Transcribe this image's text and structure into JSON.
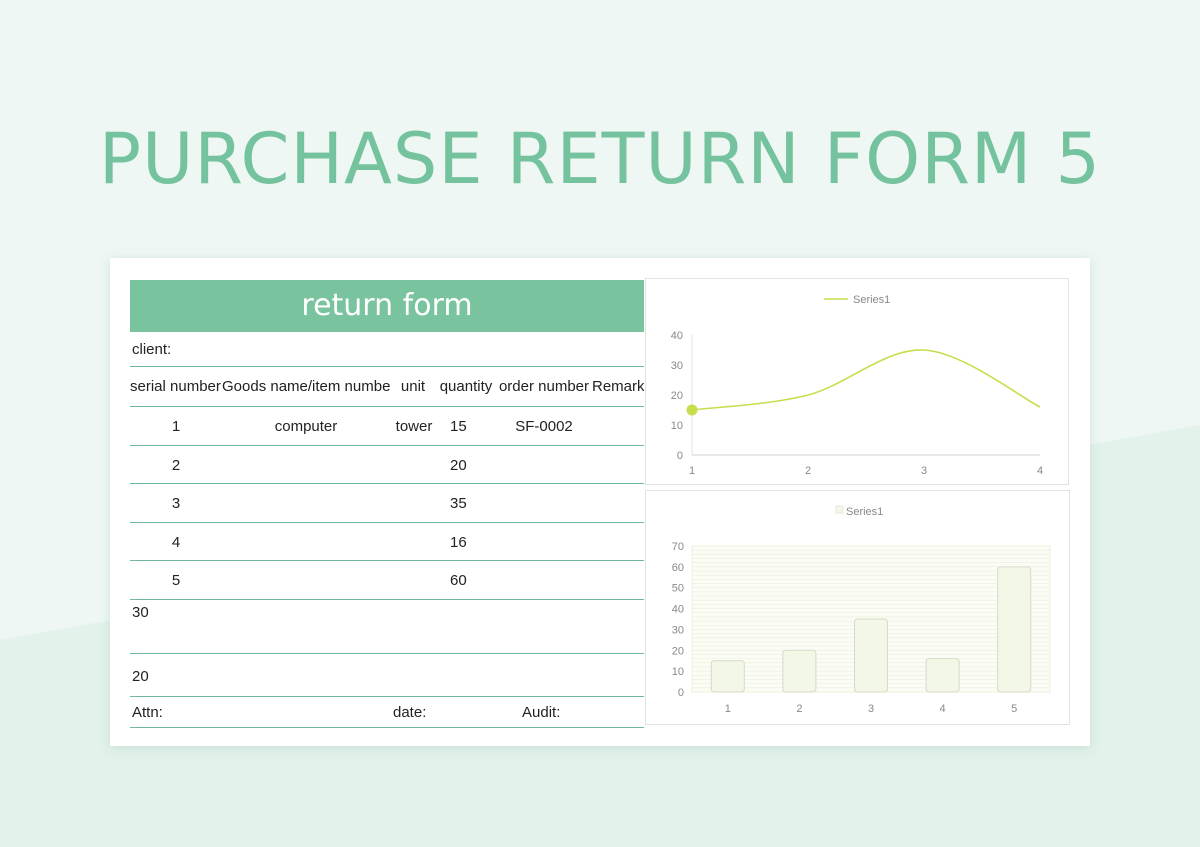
{
  "page": {
    "title": "PURCHASE RETURN FORM 5",
    "colors": {
      "title": "#74c39e",
      "header_band": "#79c39f",
      "rule": "#6fb99a",
      "line_series": "#c9dc4b",
      "bar_fill": "#f3f7e8"
    }
  },
  "form": {
    "header": "return form",
    "client_label": "client:",
    "columns": [
      "serial number",
      "Goods name/item number",
      "unit",
      "quantity",
      "order number",
      "Remark"
    ],
    "rows": [
      {
        "serial": "1",
        "goods": "computer",
        "unit": "tower",
        "quantity": "15",
        "order": "SF-0002",
        "remark": ""
      },
      {
        "serial": "2",
        "goods": "",
        "unit": "",
        "quantity": "20",
        "order": "",
        "remark": ""
      },
      {
        "serial": "3",
        "goods": "",
        "unit": "",
        "quantity": "35",
        "order": "",
        "remark": ""
      },
      {
        "serial": "4",
        "goods": "",
        "unit": "",
        "quantity": "16",
        "order": "",
        "remark": ""
      },
      {
        "serial": "5",
        "goods": "",
        "unit": "",
        "quantity": "60",
        "order": "",
        "remark": ""
      }
    ],
    "note_1": "30",
    "note_2": "20",
    "footer": {
      "attn_label": "Attn:",
      "date_label": "date:",
      "audit_label": "Audit:"
    }
  },
  "chart_data": [
    {
      "type": "line",
      "legend": "Series1",
      "legend_position": "top",
      "x": [
        1,
        2,
        3,
        4
      ],
      "series": [
        {
          "name": "Series1",
          "values": [
            15,
            20,
            35,
            16
          ]
        }
      ],
      "xlim": [
        1,
        4
      ],
      "ylim": [
        0,
        40
      ],
      "y_ticks": [
        0,
        10,
        20,
        30,
        40
      ],
      "smooth": true
    },
    {
      "type": "bar",
      "legend": "Series1",
      "legend_position": "top",
      "categories": [
        "1",
        "2",
        "3",
        "4",
        "5"
      ],
      "series": [
        {
          "name": "Series1",
          "values": [
            15,
            20,
            35,
            16,
            60
          ]
        }
      ],
      "ylim": [
        0,
        70
      ],
      "y_ticks": [
        0,
        10,
        20,
        30,
        40,
        50,
        60,
        70
      ],
      "grid": true
    }
  ]
}
